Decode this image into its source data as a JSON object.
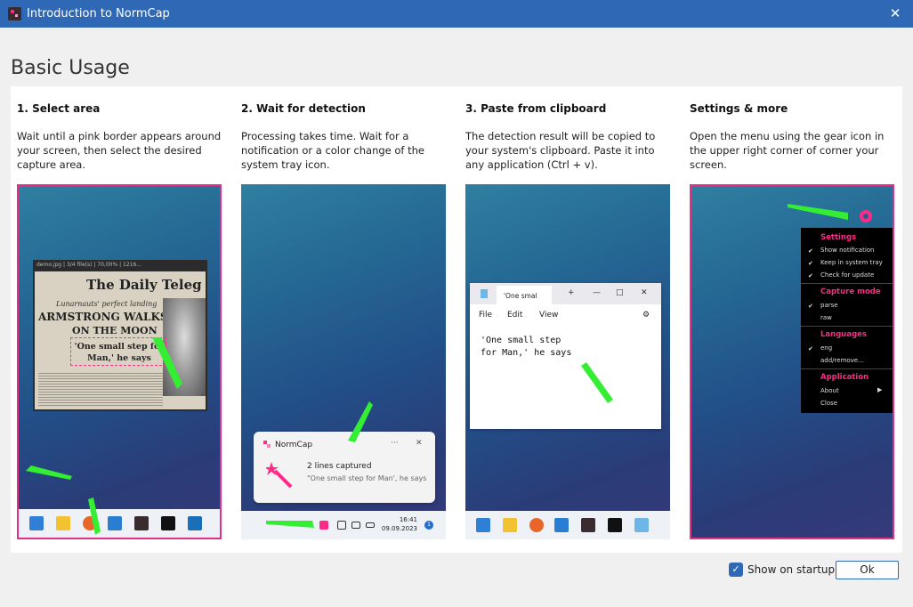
{
  "window": {
    "title": "Introduction to NormCap",
    "close_glyph": "✕"
  },
  "heading": "Basic Usage",
  "columns": [
    {
      "title": "1. Select area",
      "desc": "Wait until a pink border appears around your screen, then select the desired capture area."
    },
    {
      "title": "2. Wait for detection",
      "desc": "Processing takes time. Wait for a notification or a color change of the system tray icon."
    },
    {
      "title": "3. Paste from clipboard",
      "desc": "The detection result will be copied to your system's clipboard. Paste it into any application (Ctrl + v)."
    },
    {
      "title": "Settings & more",
      "desc": "Open the menu using the gear icon in the upper right corner of corner your screen."
    }
  ],
  "shot1": {
    "window_title": "demo.jpg | 3/4 file(s) | 70,00% | 1216...",
    "brand": "The Daily Teleg",
    "subhead": "Lunarnauts' perfect landing",
    "headline1": "ARMSTRONG WALKS",
    "headline2": "ON THE MOON",
    "quote": "'One small step for Man,' he says"
  },
  "shot2": {
    "app_name": "NormCap",
    "more_glyph": "···",
    "close_glyph": "✕",
    "line1": "2 lines captured",
    "line2": "\"One small step for Man', he says",
    "time": "16:41",
    "date": "09.09.2023",
    "badge": "1"
  },
  "shot3": {
    "tab": "'One smal",
    "menu": [
      "File",
      "Edit",
      "View"
    ],
    "body": "'One small step\nfor Man,' he says"
  },
  "shot4": {
    "sections": [
      {
        "header": "Settings",
        "items": [
          {
            "label": "Show notification",
            "checked": true
          },
          {
            "label": "Keep in system tray",
            "checked": true
          },
          {
            "label": "Check for update",
            "checked": true
          }
        ]
      },
      {
        "header": "Capture mode",
        "items": [
          {
            "label": "parse",
            "checked": true
          },
          {
            "label": "raw",
            "checked": false
          }
        ]
      },
      {
        "header": "Languages",
        "items": [
          {
            "label": "eng",
            "checked": true
          },
          {
            "label": "add/remove...",
            "checked": false
          }
        ]
      },
      {
        "header": "Application",
        "items": [
          {
            "label": "About",
            "checked": false
          },
          {
            "label": "Close",
            "checked": false
          }
        ]
      }
    ]
  },
  "footer": {
    "show_on_startup_label": "Show on startup",
    "show_on_startup_checked": true,
    "ok_label": "Ok"
  },
  "colors": {
    "accent": "#2f69b5",
    "pink": "#ff2a86",
    "arrow": "#33ee33"
  }
}
